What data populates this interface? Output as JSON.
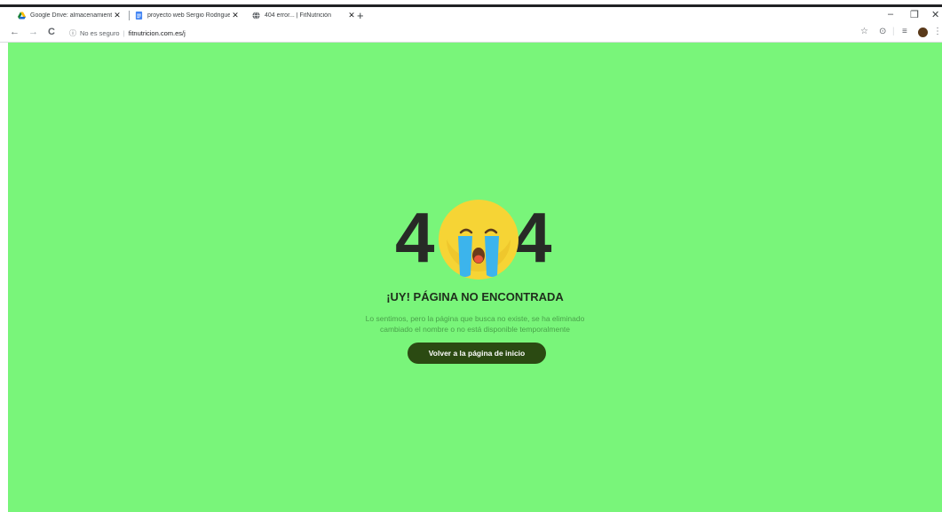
{
  "browser": {
    "tabs": [
      {
        "title": "Google Drive: almacenamiento c",
        "close": "✕",
        "favicon": "google-drive-icon"
      },
      {
        "title": "proyecto web Sergio Rodriguez",
        "close": "✕",
        "favicon": "google-docs-icon"
      },
      {
        "title": "404 error... | FitNutrición",
        "close": "✕",
        "favicon": "globe-icon"
      }
    ],
    "new_tab": "+",
    "window_controls": {
      "minimize": "–",
      "restore": "❐",
      "close": "✕"
    },
    "nav": {
      "back": "←",
      "forward": "→",
      "reload": "C"
    },
    "omnibox": {
      "security": "No es seguro",
      "url": "fitnutricion.com.es/j"
    }
  },
  "page": {
    "background": "#79f57a",
    "error_left": "4",
    "error_right": "4",
    "headline": "¡UY! PÁGINA NO ENCONTRADA",
    "message_line1": "Lo sentimos, pero la página que busca no existe, se ha eliminado",
    "message_line2": "cambiado el nombre o no está disponible temporalmente",
    "home_button": "Volver a la página de inicio"
  }
}
